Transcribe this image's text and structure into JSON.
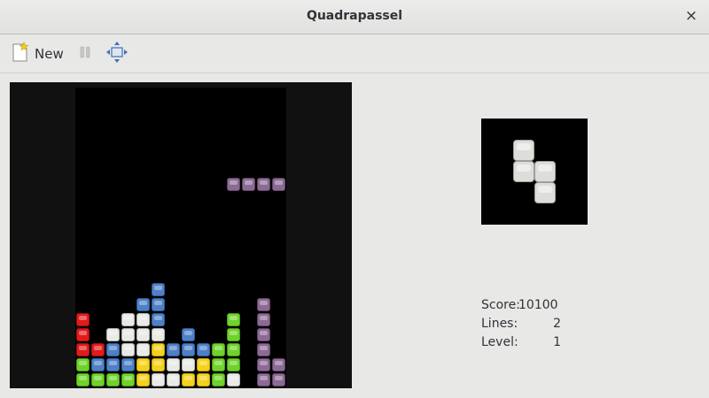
{
  "window": {
    "title": "Quadrapassel",
    "close_glyph": "×"
  },
  "toolbar": {
    "new_label": "New",
    "new_icon": "new-game-icon",
    "pause_icon": "pause-icon",
    "fullscreen_icon": "fullscreen-icon"
  },
  "colors": {
    "red": "#e01b1b",
    "green": "#6fd32a",
    "blue": "#4f80c6",
    "white": "#e9e9e6",
    "yellow": "#f4d21c",
    "purple": "#8c6a94"
  },
  "board": {
    "columns": 14,
    "rows": 20,
    "falling_piece": {
      "color": "purple",
      "cells": [
        [
          10,
          6
        ],
        [
          11,
          6
        ],
        [
          12,
          6
        ],
        [
          13,
          6
        ]
      ]
    },
    "stack": [
      {
        "row": 13,
        "cells": [
          [
            5,
            "blue"
          ]
        ]
      },
      {
        "row": 14,
        "cells": [
          [
            4,
            "blue"
          ],
          [
            5,
            "blue"
          ],
          [
            12,
            "purple"
          ]
        ]
      },
      {
        "row": 15,
        "cells": [
          [
            0,
            "red"
          ],
          [
            3,
            "white"
          ],
          [
            4,
            "white"
          ],
          [
            5,
            "blue"
          ],
          [
            10,
            "green"
          ],
          [
            12,
            "purple"
          ]
        ]
      },
      {
        "row": 16,
        "cells": [
          [
            0,
            "red"
          ],
          [
            2,
            "white"
          ],
          [
            3,
            "white"
          ],
          [
            4,
            "white"
          ],
          [
            5,
            "white"
          ],
          [
            7,
            "blue"
          ],
          [
            10,
            "green"
          ],
          [
            12,
            "purple"
          ]
        ]
      },
      {
        "row": 17,
        "cells": [
          [
            0,
            "red"
          ],
          [
            1,
            "red"
          ],
          [
            2,
            "blue"
          ],
          [
            3,
            "white"
          ],
          [
            4,
            "white"
          ],
          [
            5,
            "yellow"
          ],
          [
            6,
            "blue"
          ],
          [
            7,
            "blue"
          ],
          [
            8,
            "blue"
          ],
          [
            9,
            "green"
          ],
          [
            10,
            "green"
          ],
          [
            12,
            "purple"
          ]
        ]
      },
      {
        "row": 18,
        "cells": [
          [
            0,
            "green"
          ],
          [
            1,
            "blue"
          ],
          [
            2,
            "blue"
          ],
          [
            3,
            "blue"
          ],
          [
            4,
            "yellow"
          ],
          [
            5,
            "yellow"
          ],
          [
            6,
            "white"
          ],
          [
            7,
            "white"
          ],
          [
            8,
            "yellow"
          ],
          [
            9,
            "green"
          ],
          [
            10,
            "green"
          ],
          [
            12,
            "purple"
          ],
          [
            13,
            "purple"
          ]
        ]
      },
      {
        "row": 19,
        "cells": [
          [
            0,
            "green"
          ],
          [
            1,
            "green"
          ],
          [
            2,
            "green"
          ],
          [
            3,
            "green"
          ],
          [
            4,
            "yellow"
          ],
          [
            5,
            "white"
          ],
          [
            6,
            "white"
          ],
          [
            7,
            "yellow"
          ],
          [
            8,
            "yellow"
          ],
          [
            9,
            "green"
          ],
          [
            10,
            "white"
          ],
          [
            12,
            "purple"
          ],
          [
            13,
            "purple"
          ]
        ]
      }
    ]
  },
  "next_piece": {
    "color": "white",
    "cells": [
      [
        0,
        0
      ],
      [
        0,
        1
      ],
      [
        1,
        1
      ],
      [
        1,
        2
      ]
    ]
  },
  "stats": {
    "score_label": "Score:",
    "score_value": "10100",
    "lines_label": "Lines:",
    "lines_value": "2",
    "level_label": "Level:",
    "level_value": "1"
  }
}
